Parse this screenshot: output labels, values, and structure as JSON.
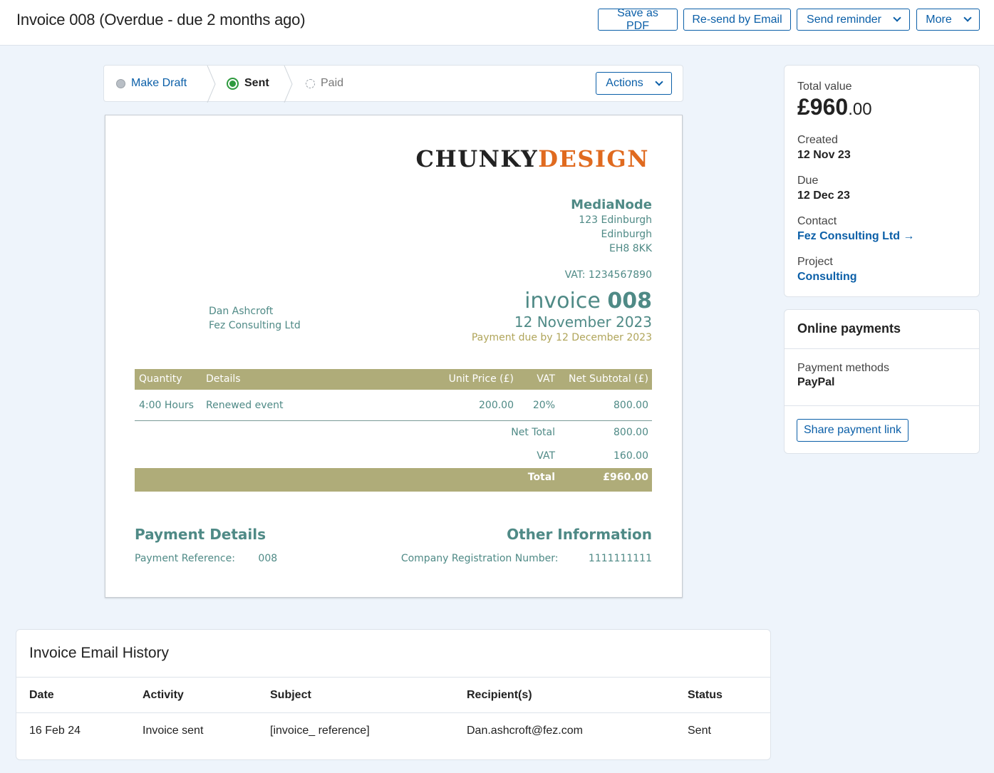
{
  "header": {
    "title": "Invoice 008 (Overdue - due 2 months ago)",
    "buttons": {
      "save_pdf": "Save as PDF",
      "resend": "Re-send by Email",
      "reminder": "Send reminder",
      "more": "More"
    }
  },
  "status": {
    "steps": [
      {
        "label": "Make Draft",
        "state": "inactive"
      },
      {
        "label": "Sent",
        "state": "current"
      },
      {
        "label": "Paid",
        "state": "pending"
      }
    ],
    "actions_label": "Actions"
  },
  "invoice": {
    "logo_part1": "CHUNKY",
    "logo_part2": "DESIGN",
    "from": {
      "company": "MediaNode",
      "address1": "123 Edinburgh",
      "address2": "Edinburgh",
      "postcode": "EH8 8KK"
    },
    "vat_number": "VAT: 1234567890",
    "to": {
      "name": "Dan Ashcroft",
      "company": "Fez Consulting Ltd"
    },
    "title_word": "invoice",
    "number": "008",
    "date": "12 November 2023",
    "payment_due": "Payment due by 12 December 2023",
    "table_headers": {
      "quantity": "Quantity",
      "details": "Details",
      "unit_price": "Unit Price (£)",
      "vat": "VAT",
      "net_subtotal": "Net Subtotal (£)"
    },
    "line_items": [
      {
        "quantity": "4:00 Hours",
        "details": "Renewed event",
        "unit_price": "200.00",
        "vat": "20%",
        "net_subtotal": "800.00"
      }
    ],
    "net_total_label": "Net Total",
    "net_total": "800.00",
    "vat_label": "VAT",
    "vat_total": "160.00",
    "total_label": "Total",
    "total": "£960.00",
    "payment_details_title": "Payment Details",
    "payment_reference_label": "Payment Reference:",
    "payment_reference": "008",
    "other_info_title": "Other Information",
    "company_reg_label": "Company Registration Number:",
    "company_reg": "1111111111"
  },
  "summary": {
    "total_value_label": "Total value",
    "total_value_main": "£960",
    "total_value_pence": ".00",
    "created_label": "Created",
    "created": "12 Nov 23",
    "due_label": "Due",
    "due": "12 Dec 23",
    "contact_label": "Contact",
    "contact": "Fez Consulting Ltd →",
    "project_label": "Project",
    "project": "Consulting"
  },
  "online_payments": {
    "title": "Online payments",
    "methods_label": "Payment methods",
    "methods": "PayPal",
    "share_button": "Share payment link"
  },
  "email_history": {
    "title": "Invoice Email History",
    "columns": [
      "Date",
      "Activity",
      "Subject",
      "Recipient(s)",
      "Status"
    ],
    "rows": [
      [
        "16 Feb 24",
        "Invoice sent",
        "[invoice_ reference]",
        "Dan.ashcroft@fez.com",
        "Sent"
      ]
    ]
  }
}
